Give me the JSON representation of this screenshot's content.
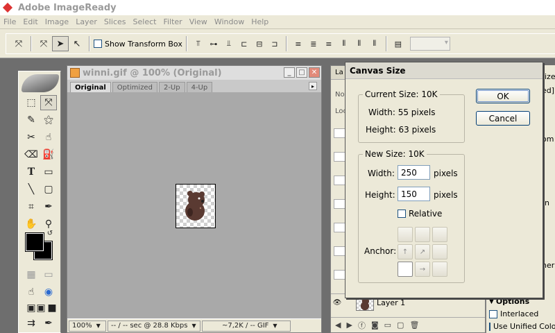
{
  "app": {
    "title": "Adobe ImageReady"
  },
  "menu": [
    "File",
    "Edit",
    "Image",
    "Layer",
    "Slices",
    "Select",
    "Filter",
    "View",
    "Window",
    "Help"
  ],
  "options": {
    "show_transform_box_label": "Show Transform Box",
    "show_transform_box_checked": false
  },
  "document": {
    "title": "winni.gif @ 100% (Original)",
    "tabs": [
      "Original",
      "Optimized",
      "2-Up",
      "4-Up"
    ],
    "active_tab": "Original",
    "status": {
      "zoom": "100%",
      "download": "-- / -- sec @ 28.8 Kbps",
      "size": "~7,2K / -- GIF"
    }
  },
  "layers_panel": {
    "tab_partial": "La",
    "row_partial_1": "No",
    "row_partial_2": "Loc",
    "layer_name": "Layer 1"
  },
  "right_panel": {
    "partials": [
      "ize",
      "ed]",
      "om",
      "n",
      "ner"
    ],
    "options_header": "Options",
    "interlaced_label": "Interlaced",
    "use_unified_label": "Use Unified Color T"
  },
  "dialog": {
    "title": "Canvas Size",
    "current_size_label": "Current Size: 10K",
    "current_width": "Width: 55 pixels",
    "current_height": "Height: 63 pixels",
    "new_size_label": "New Size: 10K",
    "width_label": "Width:",
    "width_value": "250",
    "width_unit": "pixels",
    "height_label": "Height:",
    "height_value": "150",
    "height_unit": "pixels",
    "relative_label": "Relative",
    "relative_checked": false,
    "anchor_label": "Anchor:",
    "anchor_selected": "bottom-left",
    "ok_label": "OK",
    "cancel_label": "Cancel"
  },
  "colors": {
    "foreground": "#000000",
    "background": "#000000",
    "chrome": "#ece9d8",
    "workspace": "#6e6e6e"
  }
}
